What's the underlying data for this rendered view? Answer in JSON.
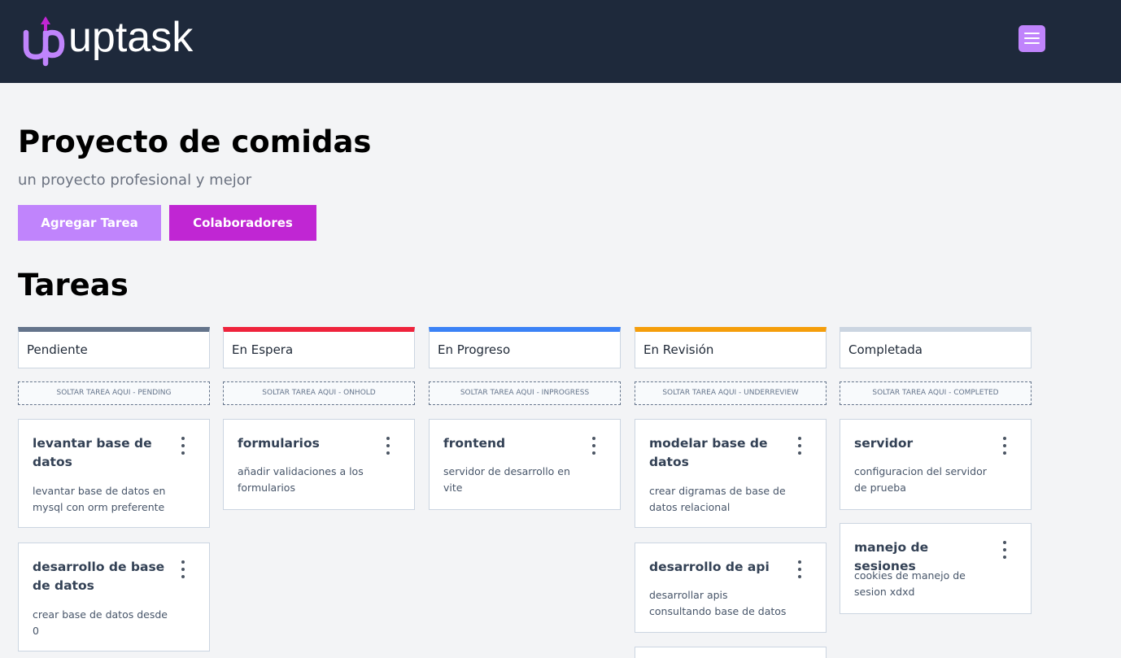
{
  "header": {
    "logo_text": "uptask",
    "brand_color": "#c084fc",
    "background": "#1e293b",
    "menu_icon": "hamburger-icon"
  },
  "project": {
    "title": "Proyecto de comidas",
    "subtitle": "un proyecto profesional y mejor"
  },
  "buttons": {
    "add_task": "Agregar Tarea",
    "collaborators": "Colaboradores"
  },
  "section_title": "Tareas",
  "columns": [
    {
      "label": "Pendiente",
      "color": "#64748b",
      "dropzone": "SOLTAR TAREA AQUI - PENDING",
      "tasks": [
        {
          "name": "levantar base de datos",
          "description": "levantar base de datos en mysql con orm preferente"
        },
        {
          "name": "desarrollo de base de datos",
          "description": "crear base de datos desde 0"
        }
      ]
    },
    {
      "label": "En Espera",
      "color": "#ef233c",
      "dropzone": "SOLTAR TAREA AQUI - ONHOLD",
      "tasks": [
        {
          "name": "formularios",
          "description": "añadir validaciones a los formularios"
        }
      ]
    },
    {
      "label": "En Progreso",
      "color": "#3b82f6",
      "dropzone": "SOLTAR TAREA AQUI - INPROGRESS",
      "tasks": [
        {
          "name": "frontend",
          "description": "servidor de desarrollo en vite"
        }
      ]
    },
    {
      "label": "En Revisión",
      "color": "#f59e0b",
      "dropzone": "SOLTAR TAREA AQUI - UNDERREVIEW",
      "tasks": [
        {
          "name": "modelar base de datos",
          "description": "crear digramas de base de datos relacional"
        },
        {
          "name": "desarrollo de api",
          "description": "desarrollar apis consultando base de datos"
        }
      ]
    },
    {
      "label": "Completada",
      "color": "#cbd5e1",
      "dropzone": "SOLTAR TAREA AQUI - COMPLETED",
      "tasks": [
        {
          "name": "servidor",
          "description": "configuracion del servidor de prueba"
        },
        {
          "name": "manejo de sesiones",
          "description": "cookies de manejo de sesion xdxd"
        }
      ]
    }
  ]
}
